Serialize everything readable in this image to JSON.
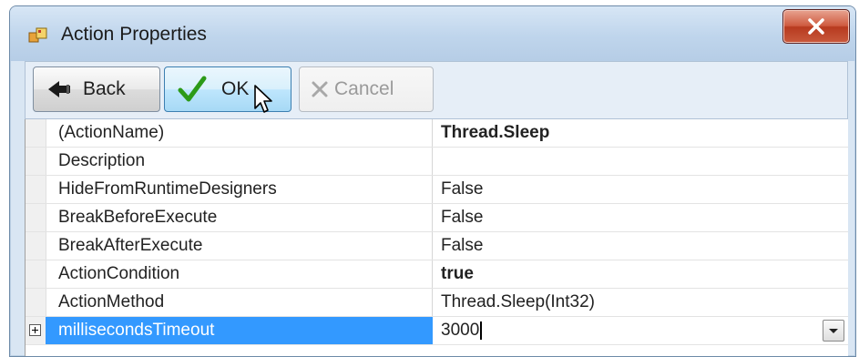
{
  "window": {
    "title": "Action Properties",
    "icon": "app-icon",
    "close_icon": "close-icon"
  },
  "toolbar": {
    "back_label": "Back",
    "back_icon": "back-arrow-icon",
    "ok_label": "OK",
    "ok_icon": "checkmark-icon",
    "cancel_label": "Cancel",
    "cancel_icon": "cancel-x-icon",
    "cancel_enabled": false
  },
  "properties": [
    {
      "name": "(ActionName)",
      "value": "Thread.Sleep",
      "bold": true
    },
    {
      "name": "Description",
      "value": ""
    },
    {
      "name": "HideFromRuntimeDesigners",
      "value": "False"
    },
    {
      "name": "BreakBeforeExecute",
      "value": "False"
    },
    {
      "name": "BreakAfterExecute",
      "value": "False"
    },
    {
      "name": "ActionCondition",
      "value": "true",
      "bold": true
    },
    {
      "name": "ActionMethod",
      "value": "Thread.Sleep(Int32)"
    },
    {
      "name": "millisecondsTimeout",
      "value": "3000",
      "selected": true,
      "expandable": true,
      "editing": true
    }
  ],
  "colors": {
    "selection": "#3399ff",
    "ok_check": "#2c9a18",
    "close_button": "#c8452a"
  }
}
